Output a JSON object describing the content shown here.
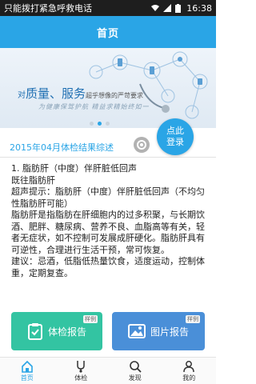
{
  "status_bar": {
    "text": "只能拨打紧急呼救电话",
    "time": "16:38",
    "icons": [
      "wifi-icon",
      "signal-icon",
      "battery-icon"
    ]
  },
  "header": {
    "title": "首页"
  },
  "banner": {
    "headline_prefix": "对",
    "headline_big": "质量、服务",
    "headline_suffix": "超乎想像的严苛要求",
    "tagline": "为健康保驾护航 精益求精始终如一"
  },
  "login_button": {
    "line1": "点此",
    "line2": "登录"
  },
  "report": {
    "title": "2015年04月体检结果综述",
    "lines": [
      "1. 脂肪肝（中度）伴肝脏低回声",
      "既往脂肪肝",
      "超声提示：脂肪肝（中度）伴肝脏低回声（不均匀性脂肪肝可能）",
      "脂肪肝是指脂肪在肝细胞内的过多积聚，与长期饮酒、肥胖、糖尿病、营养不良、血脂高等有关，轻者无症状，如不控制可发展成肝硬化。脂肪肝具有可逆性，合理进行生活干预，常可恢复。",
      "建议：忌酒，低脂低热量饮食，适度运动，控制体重，定期复查。"
    ]
  },
  "cards": {
    "checkup_label": "体检报告",
    "checkup_tag": "样例",
    "picture_label": "图片报告",
    "picture_tag": "样例"
  },
  "bottom_nav": {
    "items": [
      {
        "label": "首页",
        "icon": "home-icon"
      },
      {
        "label": "体检",
        "icon": "stethoscope-icon"
      },
      {
        "label": "发现",
        "icon": "search-icon"
      },
      {
        "label": "我的",
        "icon": "user-icon"
      }
    ]
  },
  "colors": {
    "primary": "#2aa5e6",
    "checkup_card": "#33c4a2",
    "picture_card": "#4a8fd8",
    "status_bar": "#1e1e1e"
  }
}
